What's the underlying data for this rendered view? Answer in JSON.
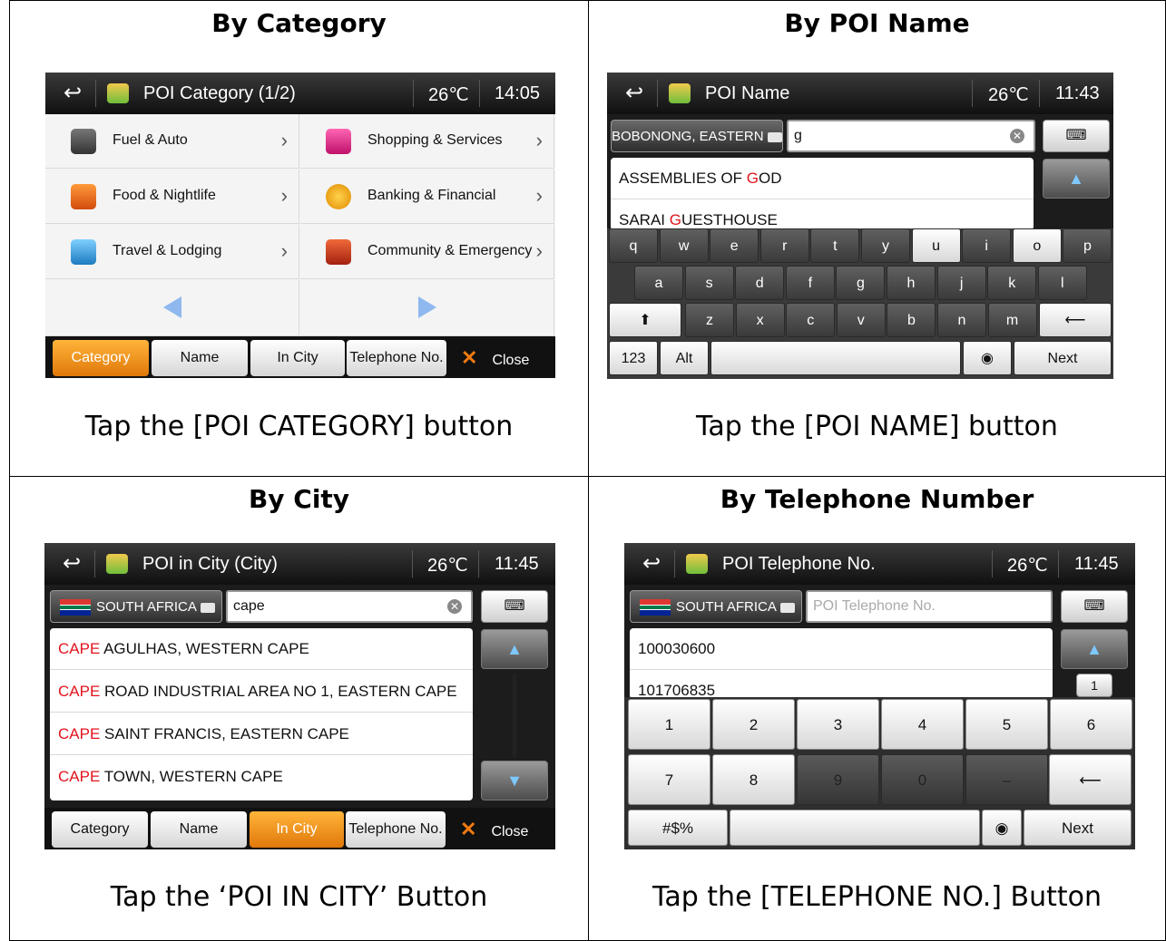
{
  "panels": {
    "category": {
      "heading": "By Category",
      "caption": "Tap the [POI CATEGORY] button",
      "topbar": {
        "title": "POI Category (1/2)",
        "temp": "26℃",
        "time": "14:05"
      },
      "items": [
        "Fuel & Auto",
        "Shopping & Services",
        "Food & Nightlife",
        "Banking & Financial",
        "Travel & Lodging",
        "Community & Emergency"
      ],
      "icons": [
        "fuel-pump-icon",
        "shopping-bag-icon",
        "fork-knife-icon",
        "dollar-coin-icon",
        "hotel-icon",
        "building-icon"
      ],
      "chevron": "›",
      "prev_arrow": "previous-page-icon",
      "next_arrow": "next-page-icon"
    },
    "name": {
      "heading": "By POI Name",
      "caption": "Tap the [POI NAME] button",
      "topbar": {
        "title": "POI Name",
        "temp": "26℃",
        "time": "11:43"
      },
      "region": "BOBONONG, EASTERN",
      "query": "g",
      "results": [
        {
          "pre": "ASSEMBLIES OF ",
          "match": "G",
          "post": "OD"
        },
        {
          "pre": "SARAI ",
          "match": "G",
          "post": "UESTHOUSE"
        }
      ],
      "keyboard": {
        "row1": [
          "q",
          "w",
          "e",
          "r",
          "t",
          "y",
          "u",
          "i",
          "o",
          "p"
        ],
        "row2": [
          "a",
          "s",
          "d",
          "f",
          "g",
          "h",
          "j",
          "k",
          "l"
        ],
        "row3": [
          "z",
          "x",
          "c",
          "v",
          "b",
          "n",
          "m"
        ],
        "mode": "123",
        "alt": "Alt",
        "next": "Next"
      }
    },
    "city": {
      "heading": "By City",
      "caption": "Tap the ‘POI IN CITY’ Button",
      "topbar": {
        "title": "POI in City (City)",
        "temp": "26℃",
        "time": "11:45"
      },
      "country": "SOUTH AFRICA",
      "query": "cape",
      "results": [
        {
          "match": "CAPE",
          "post": " AGULHAS, WESTERN CAPE"
        },
        {
          "match": "CAPE",
          "post": " ROAD INDUSTRIAL AREA NO 1, EASTERN CAPE"
        },
        {
          "match": "CAPE",
          "post": " SAINT FRANCIS, EASTERN CAPE"
        },
        {
          "match": "CAPE",
          "post": " TOWN, WESTERN CAPE"
        }
      ]
    },
    "phone": {
      "heading": "By Telephone Number",
      "caption": "Tap the [TELEPHONE NO.] Button",
      "topbar": {
        "title": "POI Telephone No.",
        "temp": "26℃",
        "time": "11:45"
      },
      "country": "SOUTH AFRICA",
      "placeholder": "POI Telephone No.",
      "results": [
        "100030600",
        "101706835"
      ],
      "page_indicator": "1",
      "keys": [
        "1",
        "2",
        "3",
        "4",
        "5",
        "6",
        "7",
        "8",
        "9",
        "0",
        "–"
      ],
      "symbols": "#$%",
      "next": "Next"
    }
  },
  "tabs": {
    "category": "Category",
    "name": "Name",
    "in_city": "In City",
    "telephone": "Telephone No.",
    "close": "Close"
  },
  "colors": {
    "active_tab": "#f0921c",
    "highlight": "#e0141e",
    "header_bg": "#1a1a1a"
  }
}
